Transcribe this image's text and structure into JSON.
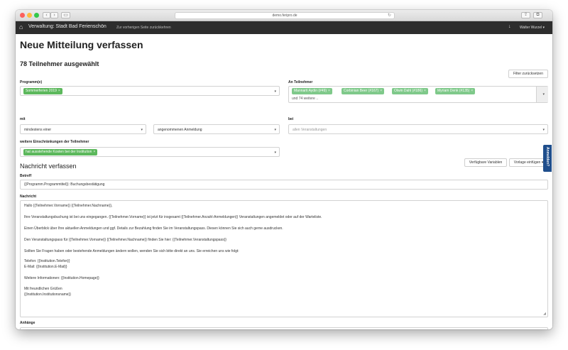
{
  "browser": {
    "url": "demo.feripro.de",
    "back_glyph": "‹",
    "forward_glyph": "›",
    "sidebar_glyph": "▭",
    "reload_glyph": "↻",
    "share_glyph": "⇪",
    "tabs_glyph": "⧉"
  },
  "appnav": {
    "home_icon": "⌂",
    "brand": "Verwaltung: Stadt Bad Ferienschön",
    "back_link": "Zur vorherigen Seite zurückkehren",
    "download_icon": "↓",
    "user": "Walter Wurzel ▾"
  },
  "page": {
    "title": "Neue Mitteilung verfassen",
    "selected_count": "78 Teilnehmer ausgewählt",
    "reset_filter": "Filter zurücksetzen"
  },
  "filters": {
    "programm_label": "Programm(e)",
    "programm_tag": "Sommerferien 2019",
    "mit_label": "mit",
    "mit_value": "mindestens einer",
    "anmeldung_value": "angenommenen Anmeldung",
    "bei_label": "bei",
    "bei_placeholder": "allen Veranstaltungen",
    "einschr_label": "weitere Einschränkungen der Teilnehmer",
    "einschr_tag": "hat ausstehende Kosten bei der Institution",
    "an_label": "An Teilnehmer",
    "an_tags": [
      "Mannarti Aydin (#49)",
      "Corbinian Beer (#167)",
      "Olwin Dahl (#186)",
      "Myriam Denk (#135)"
    ],
    "an_more": "und 74 weitere ..",
    "tag_remove": "×",
    "caret": "▾"
  },
  "compose": {
    "heading": "Nachricht verfassen",
    "vars_button": "Verfügbare Variablen",
    "insert_button": "Vorlage einfügen ▾",
    "betreff_label": "Betreff",
    "betreff_value": "{{Programm.Programmtitel}}: Buchungsbestätigung",
    "nachricht_label": "Nachricht",
    "lines": [
      "Hallo {{Teilnehmer.Vorname}} {{Teilnehmer.Nachname}},",
      "Ihre Veranstaltungsbuchung ist bei uns eingegangen. {{Teilnehmer.Vorname}} ist jetzt für insgesamt {{Teilnehmer.Anzahl-Anmeldungen}} Veranstaltungen angemeldet oder auf der Warteliste.",
      "Einen Überblick über Ihre aktuellen Anmeldungen und ggf. Details zur Bezahlung finden Sie im Veranstaltungspass. Diesen können Sie sich auch gerne ausdrucken.",
      "Den Veranstaltungspass für {{Teilnehmer.Vorname}} {{Teilnehmer.Nachname}} finden Sie hier: {{Teilnehmer.Veranstaltungspass}}",
      "Sollten Sie Fragen haben oder bestehende Anmeldungen ändern wollen, wenden Sie sich bitte direkt an uns. Sie erreichen uns wie folgt:",
      "Telefon: {{Institution.Telefon}}",
      "E-Mail: {{Institution.E-Mail}}",
      "Weitere Informationen: {{Institution.Homepage}}",
      "Mit freundlichen Grüßen",
      "{{Institution.Institutionsname}}"
    ],
    "anhaenge_label": "Anhänge",
    "resize_glyph": "◢"
  },
  "sidetab": {
    "label": "Anmelden?"
  }
}
